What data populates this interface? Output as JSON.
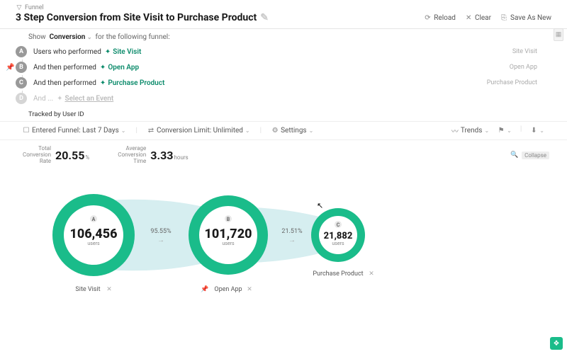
{
  "breadcrumb": "Funnel",
  "title": "3 Step Conversion from Site Visit to Purchase Product",
  "actions": {
    "reload": "Reload",
    "clear": "Clear",
    "save": "Save As New"
  },
  "show": {
    "label": "Show",
    "type": "Conversion",
    "suffix": "for the following funnel:"
  },
  "steps": [
    {
      "letter": "A",
      "text": "Users who performed",
      "event": "Site Visit",
      "right": "Site Visit"
    },
    {
      "letter": "B",
      "text": "And then performed",
      "event": "Open App",
      "right": "Open App",
      "pinned": true
    },
    {
      "letter": "C",
      "text": "And then performed",
      "event": "Purchase Product",
      "right": "Purchase Product"
    },
    {
      "letter": "D",
      "text": "And ...",
      "event": "Select an Event",
      "muted": true
    }
  ],
  "tracked": "Tracked by User ID",
  "collapse": "Collapse",
  "toolbar": {
    "range": "Entered Funnel: Last 7 Days",
    "limit": "Conversion Limit: Unlimited",
    "settings": "Settings",
    "trends": "Trends"
  },
  "metrics": {
    "conv_label": "Total\nConversion\nRate",
    "conv_value": "20.55",
    "conv_unit": "%",
    "time_label": "Average\nConversion\nTime",
    "time_value": "3.33",
    "time_unit": "hours"
  },
  "zoom": "100%",
  "chart_data": {
    "type": "funnel-ring",
    "nodes": [
      {
        "letter": "A",
        "value": 106456,
        "label": "106,456",
        "unit": "users",
        "caption": "Site Visit"
      },
      {
        "letter": "B",
        "value": 101720,
        "label": "101,720",
        "unit": "users",
        "caption": "Open App",
        "pinned": true
      },
      {
        "letter": "C",
        "value": 21882,
        "label": "21,882",
        "unit": "users",
        "caption": "Purchase Product"
      }
    ],
    "conversions": [
      {
        "from": "A",
        "to": "B",
        "rate": 95.55,
        "label": "95.55%"
      },
      {
        "from": "B",
        "to": "C",
        "rate": 21.51,
        "label": "21.51%"
      }
    ]
  }
}
